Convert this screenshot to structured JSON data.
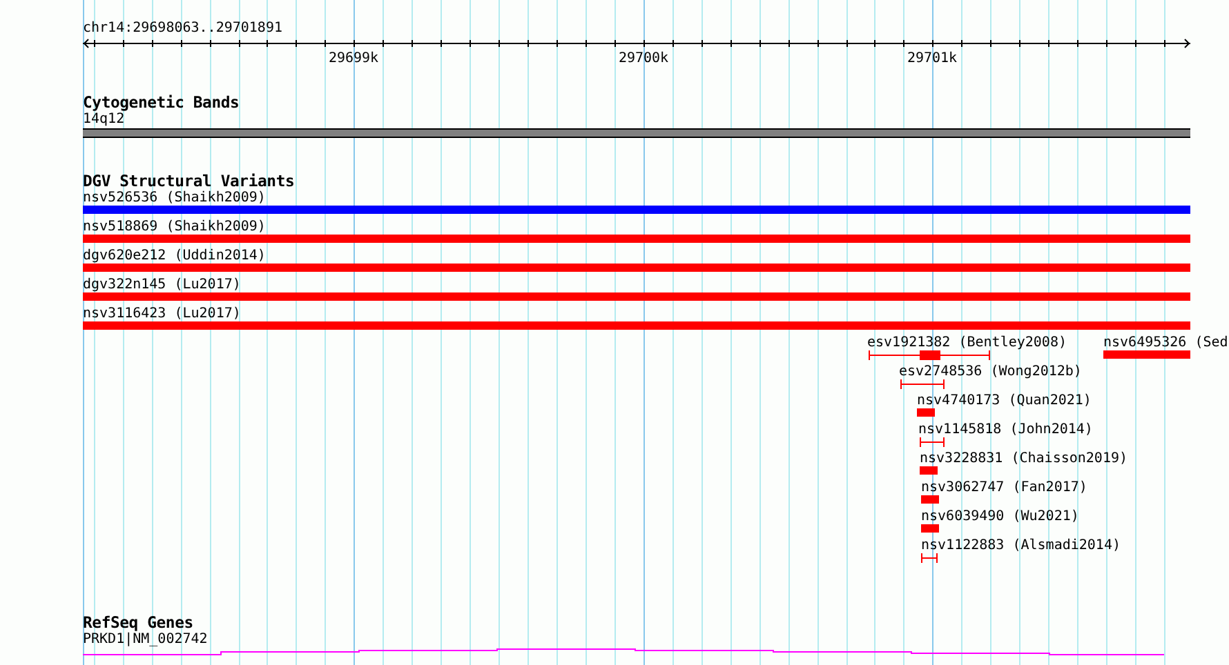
{
  "ruler": {
    "location": "chr14:29698063..29701891",
    "tick_labels": [
      "29699k",
      "29700k",
      "29701k"
    ]
  },
  "tracks": [
    {
      "kind": "cytoband",
      "title": "Cytogenetic Bands",
      "features": [
        {
          "label": "14q12",
          "kind": "band",
          "color": "#808080"
        }
      ]
    },
    {
      "kind": "variants",
      "title": "DGV Structural Variants",
      "features": [
        {
          "label": "nsv526536 (Shaikh2009)",
          "kind": "solid",
          "color": "#0000ff"
        },
        {
          "label": "nsv518869 (Shaikh2009)",
          "kind": "solid",
          "color": "#ff0000"
        },
        {
          "label": "dgv620e212 (Uddin2014)",
          "kind": "solid",
          "color": "#ff0000"
        },
        {
          "label": "dgv322n145 (Lu2017)",
          "kind": "solid",
          "color": "#ff0000"
        },
        {
          "label": "nsv3116423 (Lu2017)",
          "kind": "solid",
          "color": "#ff0000"
        },
        {
          "label": "esv1921382 (Bentley2008)",
          "kind": "interval_core",
          "color": "#ff0000"
        },
        {
          "label": "nsv6495326 (Sed",
          "kind": "solid",
          "color": "#ff0000"
        },
        {
          "label": "esv2748536 (Wong2012b)",
          "kind": "interval",
          "color": "#ff0000"
        },
        {
          "label": "nsv4740173 (Quan2021)",
          "kind": "solid",
          "color": "#ff0000"
        },
        {
          "label": "nsv1145818 (John2014)",
          "kind": "interval",
          "color": "#ff0000"
        },
        {
          "label": "nsv3228831 (Chaisson2019)",
          "kind": "solid",
          "color": "#ff0000"
        },
        {
          "label": "nsv3062747 (Fan2017)",
          "kind": "solid",
          "color": "#ff0000"
        },
        {
          "label": "nsv6039490 (Wu2021)",
          "kind": "solid",
          "color": "#ff0000"
        },
        {
          "label": "nsv1122883 (Alsmadi2014)",
          "kind": "interval",
          "color": "#ff0000"
        }
      ]
    },
    {
      "kind": "genes",
      "title": "RefSeq Genes",
      "features": [
        {
          "label": "PRKD1|NM_002742",
          "kind": "gene",
          "color": "#ff00ff"
        }
      ]
    }
  ]
}
